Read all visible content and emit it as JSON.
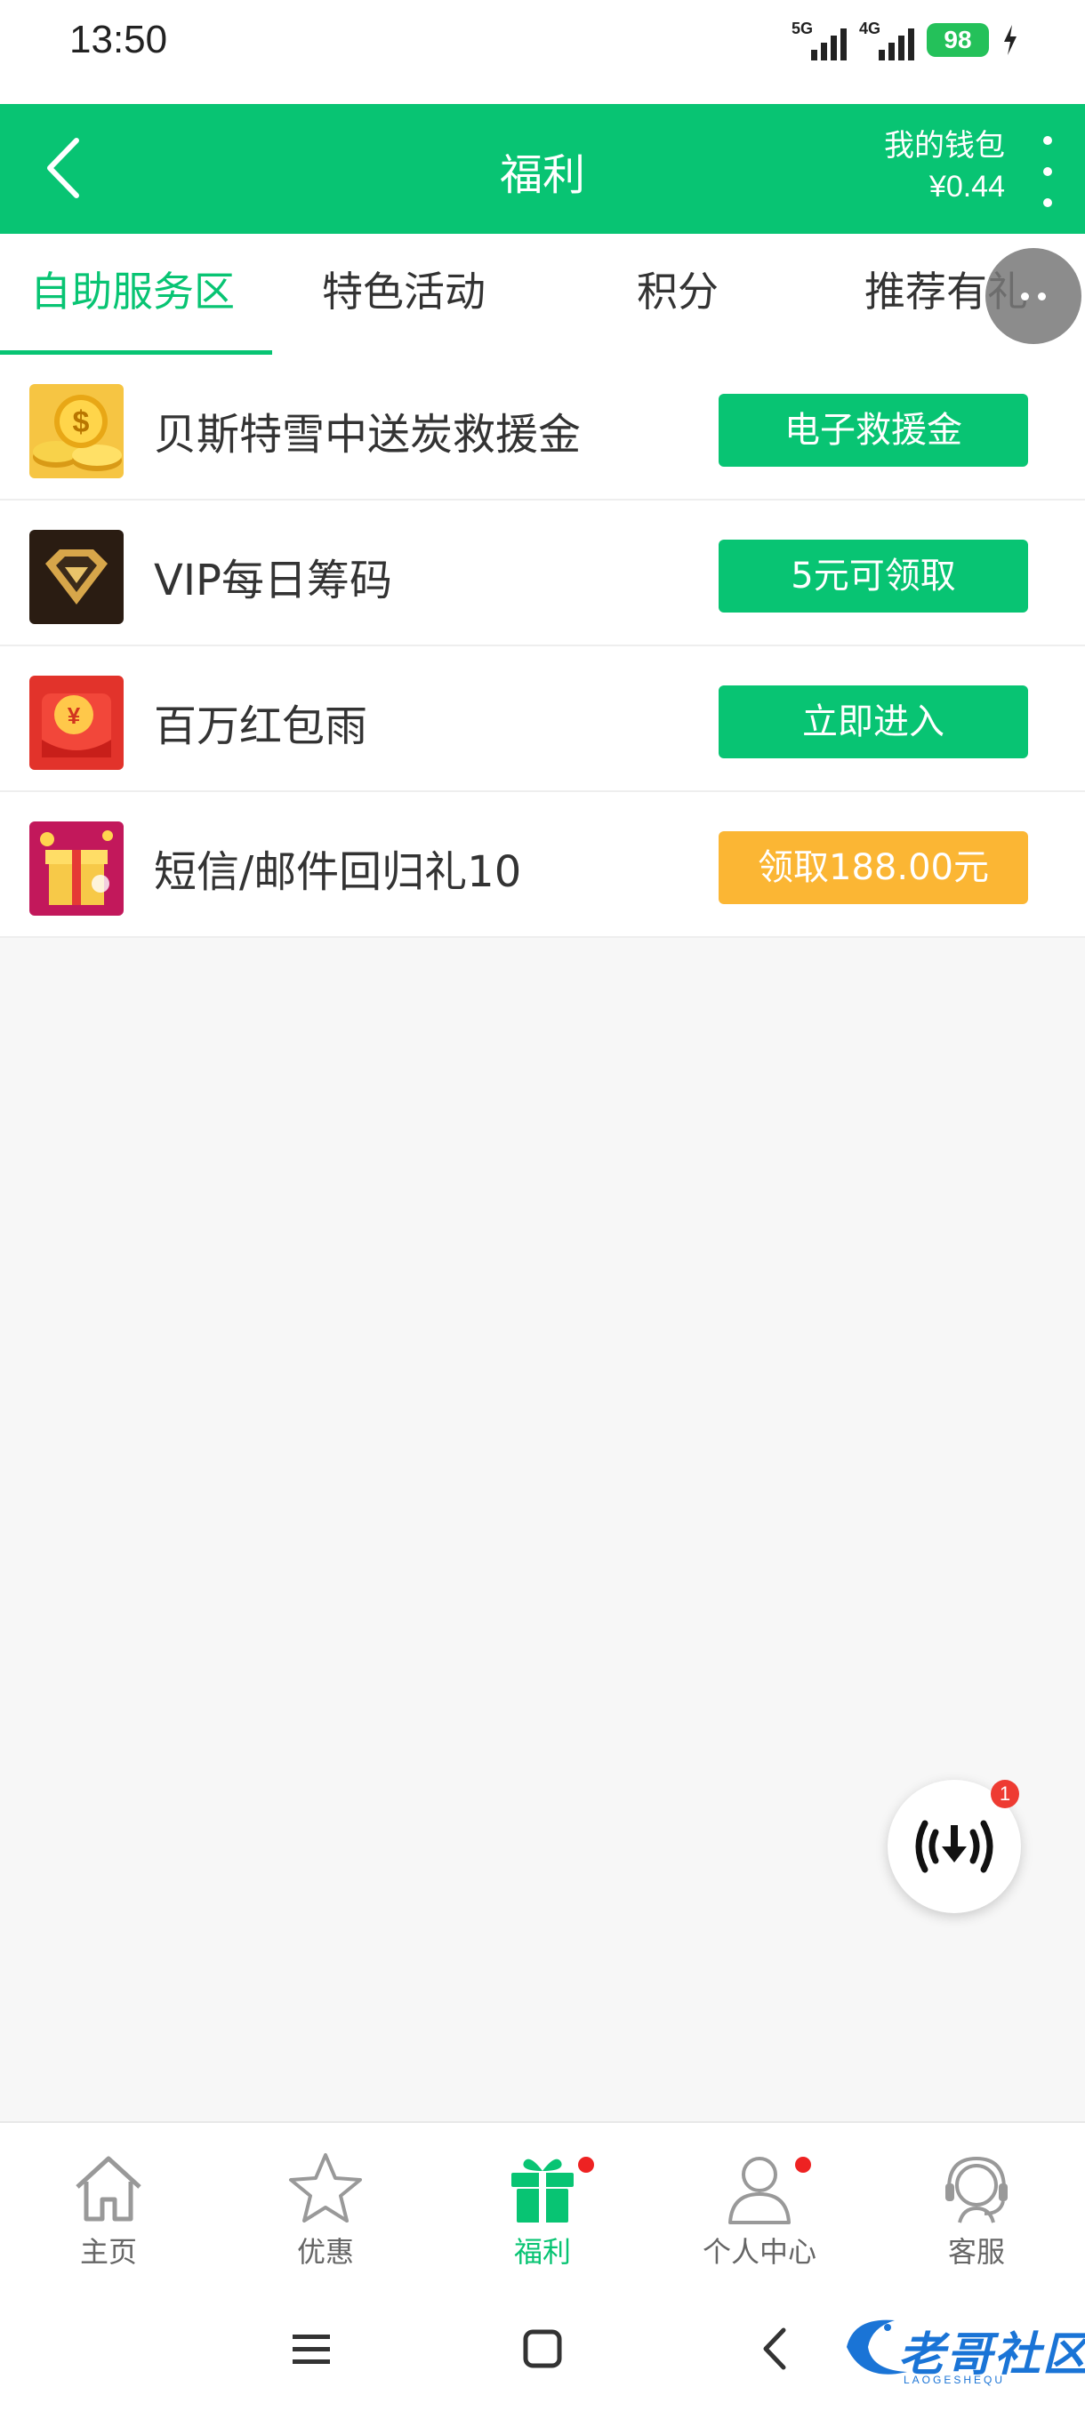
{
  "status_bar": {
    "time": "13:50",
    "network_1": "5G",
    "network_2": "4G",
    "battery": "98"
  },
  "header": {
    "title": "福利",
    "wallet_label": "我的钱包",
    "wallet_amount": "¥0.44"
  },
  "tabs": [
    {
      "label": "自助服务区",
      "active": true
    },
    {
      "label": "特色活动",
      "active": false
    },
    {
      "label": "积分",
      "active": false
    },
    {
      "label": "推荐有礼",
      "active": false
    }
  ],
  "list": [
    {
      "title": "贝斯特雪中送炭救援金",
      "button": "电子救援金",
      "button_color": "#08c473",
      "icon": "gold-coins-icon"
    },
    {
      "title": "VIP每日筹码",
      "button": "5元可领取",
      "button_color": "#08c473",
      "icon": "vip-diamond-icon"
    },
    {
      "title": "百万红包雨",
      "button": "立即进入",
      "button_color": "#08c473",
      "icon": "red-envelope-icon"
    },
    {
      "title": "短信/邮件回归礼10",
      "button": "领取188.00元",
      "button_color": "#fbb634",
      "icon": "gift-box-icon"
    }
  ],
  "fab": {
    "badge": "1",
    "icon": "download-broadcast-icon"
  },
  "bottom_nav": [
    {
      "label": "主页",
      "icon": "home-icon",
      "active": false,
      "dot": false
    },
    {
      "label": "优惠",
      "icon": "star-icon",
      "active": false,
      "dot": false
    },
    {
      "label": "福利",
      "icon": "gift-icon",
      "active": true,
      "dot": true
    },
    {
      "label": "个人中心",
      "icon": "user-icon",
      "active": false,
      "dot": true
    },
    {
      "label": "客服",
      "icon": "headset-icon",
      "active": false,
      "dot": false
    }
  ],
  "watermark": {
    "text": "老哥社区",
    "sub": "LAOGESHEQU"
  },
  "colors": {
    "primary": "#08c473",
    "accent_orange": "#fbb634",
    "badge_red": "#ee3b32"
  }
}
